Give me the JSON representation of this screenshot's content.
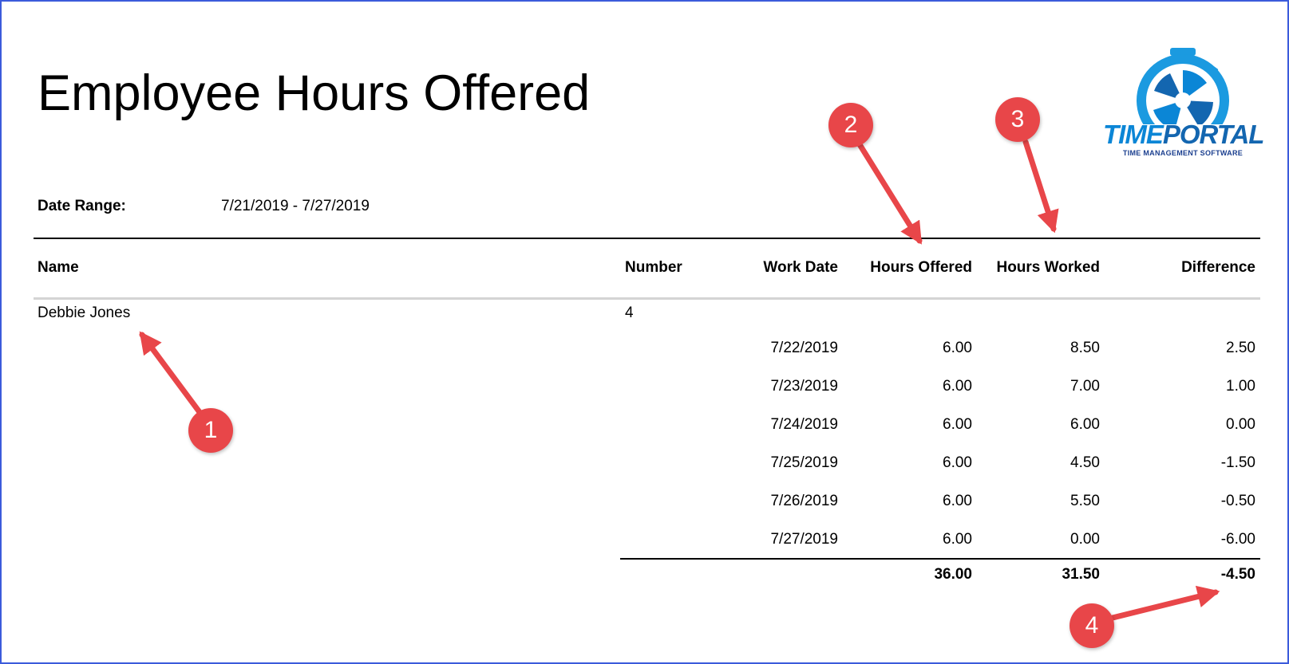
{
  "report": {
    "title": "Employee Hours Offered",
    "date_range_label": "Date Range:",
    "date_range_value": "7/21/2019 - 7/27/2019"
  },
  "logo": {
    "name_part1": "TIME",
    "name_part2": "PORTAL",
    "tagline": "TIME MANAGEMENT SOFTWARE"
  },
  "table": {
    "headers": {
      "name": "Name",
      "number": "Number",
      "work_date": "Work Date",
      "hours_offered": "Hours Offered",
      "hours_worked": "Hours Worked",
      "difference": "Difference"
    },
    "employee": {
      "name": "Debbie Jones",
      "number": "4"
    },
    "rows": [
      {
        "work_date": "7/22/2019",
        "hours_offered": "6.00",
        "hours_worked": "8.50",
        "difference": "2.50"
      },
      {
        "work_date": "7/23/2019",
        "hours_offered": "6.00",
        "hours_worked": "7.00",
        "difference": "1.00"
      },
      {
        "work_date": "7/24/2019",
        "hours_offered": "6.00",
        "hours_worked": "6.00",
        "difference": "0.00"
      },
      {
        "work_date": "7/25/2019",
        "hours_offered": "6.00",
        "hours_worked": "4.50",
        "difference": "-1.50"
      },
      {
        "work_date": "7/26/2019",
        "hours_offered": "6.00",
        "hours_worked": "5.50",
        "difference": "-0.50"
      },
      {
        "work_date": "7/27/2019",
        "hours_offered": "6.00",
        "hours_worked": "0.00",
        "difference": "-6.00"
      }
    ],
    "totals": {
      "hours_offered": "36.00",
      "hours_worked": "31.50",
      "difference": "-4.50"
    }
  },
  "callouts": [
    {
      "label": "1"
    },
    {
      "label": "2"
    },
    {
      "label": "3"
    },
    {
      "label": "4"
    }
  ],
  "colors": {
    "frame_border": "#3b5bdb",
    "callout": "#e84649",
    "logo_blue": "#0b86d6",
    "logo_dark_blue": "#1366b0"
  }
}
